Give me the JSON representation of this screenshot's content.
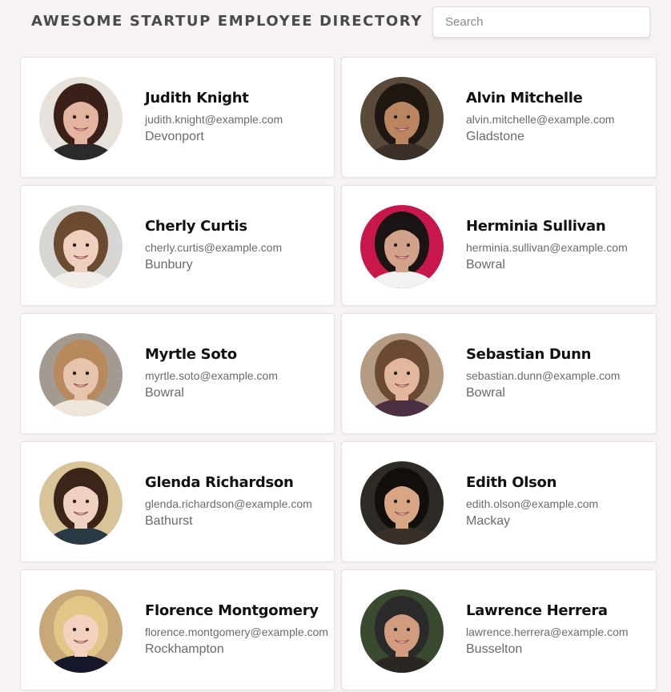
{
  "header": {
    "title": "AWESOME STARTUP EMPLOYEE DIRECTORY"
  },
  "search": {
    "placeholder": "Search"
  },
  "employees": [
    {
      "name": "Judith Knight",
      "email": "judith.knight@example.com",
      "city": "Devonport",
      "bg": "#e7e2dc",
      "hair": "#3a2018",
      "skin": "#e3b4a0",
      "shirt": "#2a2a2a"
    },
    {
      "name": "Alvin Mitchelle",
      "email": "alvin.mitchelle@example.com",
      "city": "Gladstone",
      "bg": "#5a4a3a",
      "hair": "#1e1712",
      "skin": "#b98661",
      "shirt": "#3a3028"
    },
    {
      "name": "Cherly Curtis",
      "email": "cherly.curtis@example.com",
      "city": "Bunbury",
      "bg": "#d8d6d2",
      "hair": "#6b4a32",
      "skin": "#efcfbd",
      "shirt": "#f1eeea"
    },
    {
      "name": "Herminia Sullivan",
      "email": "herminia.sullivan@example.com",
      "city": "Bowral",
      "bg": "#c8174a",
      "hair": "#1a1414",
      "skin": "#d3a28a",
      "shirt": "#f2f2f2"
    },
    {
      "name": "Myrtle Soto",
      "email": "myrtle.soto@example.com",
      "city": "Bowral",
      "bg": "#a39b92",
      "hair": "#b8895c",
      "skin": "#e7c4ad",
      "shirt": "#efe6da"
    },
    {
      "name": "Sebastian Dunn",
      "email": "sebastian.dunn@example.com",
      "city": "Bowral",
      "bg": "#b59a84",
      "hair": "#6a4a34",
      "skin": "#e2b79d",
      "shirt": "#4a3040"
    },
    {
      "name": "Glenda Richardson",
      "email": "glenda.richardson@example.com",
      "city": "Bathurst",
      "bg": "#d9c49a",
      "hair": "#3b2418",
      "skin": "#f0d0c0",
      "shirt": "#2a3a44"
    },
    {
      "name": "Edith Olson",
      "email": "edith.olson@example.com",
      "city": "Mackay",
      "bg": "#2e2a26",
      "hair": "#120e0c",
      "skin": "#d8a684",
      "shirt": "#3a302a"
    },
    {
      "name": "Florence Montgomery",
      "email": "florence.montgomery@example.com",
      "city": "Rockhampton",
      "bg": "#c8a878",
      "hair": "#e2c688",
      "skin": "#f2d2be",
      "shirt": "#14182a"
    },
    {
      "name": "Lawrence Herrera",
      "email": "lawrence.herrera@example.com",
      "city": "Busselton",
      "bg": "#3a4a30",
      "hair": "#2a2a2a",
      "skin": "#d29c7e",
      "shirt": "#2a2622"
    }
  ]
}
